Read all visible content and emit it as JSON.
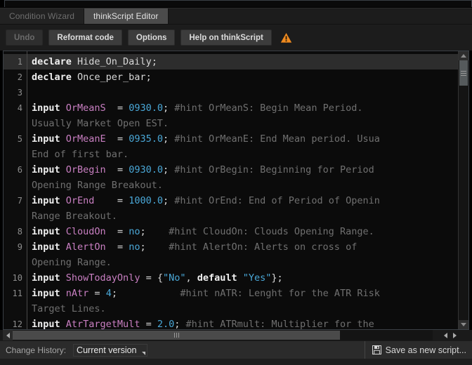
{
  "tabs": [
    {
      "label": "Condition Wizard",
      "active": false,
      "enabled": false
    },
    {
      "label": "thinkScript Editor",
      "active": true,
      "enabled": true
    }
  ],
  "toolbar": {
    "undo_label": "Undo",
    "reformat_label": "Reformat code",
    "options_label": "Options",
    "help_label": "Help on thinkScript",
    "warning_icon": "warning-triangle-icon",
    "warning_color": "#ef8a1f"
  },
  "editor": {
    "current_line": 1,
    "colors": {
      "keyword": "#f0f0f0",
      "identifier": "#c97fc2",
      "number": "#4aa8d8",
      "comment": "#707070",
      "background": "#0b0b0b",
      "current_line_bg": "#2d2d2d"
    },
    "lines": [
      {
        "num": 1,
        "current": true,
        "tokens": [
          {
            "t": "declare ",
            "c": "k"
          },
          {
            "t": "Hide_On_Daily;",
            "c": "p"
          }
        ]
      },
      {
        "num": 2,
        "current": false,
        "tokens": [
          {
            "t": "declare ",
            "c": "k"
          },
          {
            "t": "Once_per_bar;",
            "c": "p"
          }
        ]
      },
      {
        "num": 3,
        "current": false,
        "tokens": []
      },
      {
        "num": 4,
        "current": false,
        "tokens": [
          {
            "t": "input ",
            "c": "k"
          },
          {
            "t": "OrMeanS",
            "c": "id"
          },
          {
            "t": "  = ",
            "c": "p"
          },
          {
            "t": "0930.0",
            "c": "n"
          },
          {
            "t": "; ",
            "c": "p"
          },
          {
            "t": "#hint OrMeanS: Begin Mean Period.",
            "c": "c"
          }
        ]
      },
      {
        "num": null,
        "current": false,
        "tokens": [
          {
            "t": "Usually Market Open EST.",
            "c": "c"
          }
        ]
      },
      {
        "num": 5,
        "current": false,
        "tokens": [
          {
            "t": "input ",
            "c": "k"
          },
          {
            "t": "OrMeanE",
            "c": "id"
          },
          {
            "t": "  = ",
            "c": "p"
          },
          {
            "t": "0935.0",
            "c": "n"
          },
          {
            "t": "; ",
            "c": "p"
          },
          {
            "t": "#hint OrMeanE: End Mean period. Usua",
            "c": "c"
          }
        ]
      },
      {
        "num": null,
        "current": false,
        "tokens": [
          {
            "t": "End of first bar.",
            "c": "c"
          }
        ]
      },
      {
        "num": 6,
        "current": false,
        "tokens": [
          {
            "t": "input ",
            "c": "k"
          },
          {
            "t": "OrBegin",
            "c": "id"
          },
          {
            "t": "  = ",
            "c": "p"
          },
          {
            "t": "0930.0",
            "c": "n"
          },
          {
            "t": "; ",
            "c": "p"
          },
          {
            "t": "#hint OrBegin: Beginning for Period",
            "c": "c"
          }
        ]
      },
      {
        "num": null,
        "current": false,
        "tokens": [
          {
            "t": "Opening Range Breakout.",
            "c": "c"
          }
        ]
      },
      {
        "num": 7,
        "current": false,
        "tokens": [
          {
            "t": "input ",
            "c": "k"
          },
          {
            "t": "OrEnd",
            "c": "id"
          },
          {
            "t": "    = ",
            "c": "p"
          },
          {
            "t": "1000.0",
            "c": "n"
          },
          {
            "t": "; ",
            "c": "p"
          },
          {
            "t": "#hint OrEnd: End of Period of Openin",
            "c": "c"
          }
        ]
      },
      {
        "num": null,
        "current": false,
        "tokens": [
          {
            "t": "Range Breakout.",
            "c": "c"
          }
        ]
      },
      {
        "num": 8,
        "current": false,
        "tokens": [
          {
            "t": "input ",
            "c": "k"
          },
          {
            "t": "CloudOn",
            "c": "id"
          },
          {
            "t": "  = ",
            "c": "p"
          },
          {
            "t": "no",
            "c": "n"
          },
          {
            "t": ";    ",
            "c": "p"
          },
          {
            "t": "#hint CloudOn: Clouds Opening Range.",
            "c": "c"
          }
        ]
      },
      {
        "num": 9,
        "current": false,
        "tokens": [
          {
            "t": "input ",
            "c": "k"
          },
          {
            "t": "AlertOn",
            "c": "id"
          },
          {
            "t": "  = ",
            "c": "p"
          },
          {
            "t": "no",
            "c": "n"
          },
          {
            "t": ";    ",
            "c": "p"
          },
          {
            "t": "#hint AlertOn: Alerts on cross of",
            "c": "c"
          }
        ]
      },
      {
        "num": null,
        "current": false,
        "tokens": [
          {
            "t": "Opening Range.",
            "c": "c"
          }
        ]
      },
      {
        "num": 10,
        "current": false,
        "tokens": [
          {
            "t": "input ",
            "c": "k"
          },
          {
            "t": "ShowTodayOnly",
            "c": "id"
          },
          {
            "t": " = {",
            "c": "p"
          },
          {
            "t": "\"No\"",
            "c": "n"
          },
          {
            "t": ", ",
            "c": "p"
          },
          {
            "t": "default ",
            "c": "k"
          },
          {
            "t": "\"Yes\"",
            "c": "n"
          },
          {
            "t": "};",
            "c": "p"
          }
        ]
      },
      {
        "num": 11,
        "current": false,
        "tokens": [
          {
            "t": "input ",
            "c": "k"
          },
          {
            "t": "nAtr",
            "c": "id"
          },
          {
            "t": " = ",
            "c": "p"
          },
          {
            "t": "4",
            "c": "n"
          },
          {
            "t": ";           ",
            "c": "p"
          },
          {
            "t": "#hint nATR: Lenght for the ATR Risk",
            "c": "c"
          }
        ]
      },
      {
        "num": null,
        "current": false,
        "tokens": [
          {
            "t": "Target Lines.",
            "c": "c"
          }
        ]
      },
      {
        "num": 12,
        "current": false,
        "tokens": [
          {
            "t": "input ",
            "c": "k"
          },
          {
            "t": "AtrTargetMult",
            "c": "id"
          },
          {
            "t": " = ",
            "c": "p"
          },
          {
            "t": "2.0",
            "c": "n"
          },
          {
            "t": "; ",
            "c": "p"
          },
          {
            "t": "#hint ATRmult: Multiplier for the",
            "c": "c"
          }
        ]
      }
    ]
  },
  "scrollbars": {
    "vertical_up_icon": "triangle-up-icon",
    "vertical_down_icon": "triangle-down-icon",
    "horizontal_left_icon": "triangle-left-icon",
    "horizontal_right_icon": "triangle-right-icon"
  },
  "status": {
    "change_history_label": "Change History:",
    "current_version_value": "Current version",
    "save_icon": "floppy-disk-icon",
    "save_label": "Save as new script..."
  }
}
